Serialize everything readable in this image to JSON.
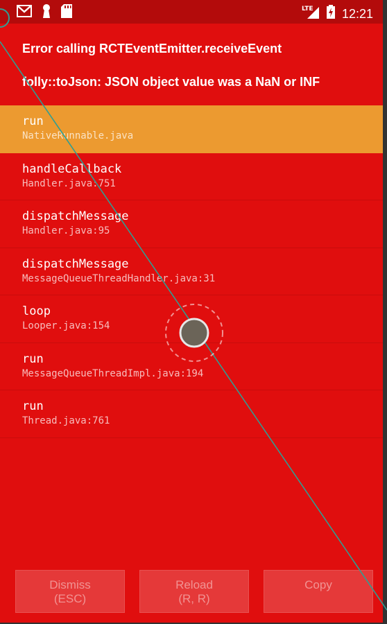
{
  "status_bar": {
    "icons": [
      "gmail-icon",
      "keyhole-icon",
      "sd-card-icon"
    ],
    "network": "LTE",
    "time": "12:21"
  },
  "error": {
    "title": "Error calling RCTEventEmitter.receiveEvent",
    "message": "folly::toJson: JSON object value was a NaN or INF"
  },
  "stack_frames": [
    {
      "method": "run",
      "file": "NativeRunnable.java",
      "highlighted": true
    },
    {
      "method": "handleCallback",
      "file": "Handler.java:751"
    },
    {
      "method": "dispatchMessage",
      "file": "Handler.java:95"
    },
    {
      "method": "dispatchMessage",
      "file": "MessageQueueThreadHandler.java:31"
    },
    {
      "method": "loop",
      "file": "Looper.java:154"
    },
    {
      "method": "run",
      "file": "MessageQueueThreadImpl.java:194"
    },
    {
      "method": "run",
      "file": "Thread.java:761"
    }
  ],
  "buttons": {
    "dismiss_line1": "Dismiss",
    "dismiss_line2": "(ESC)",
    "reload_line1": "Reload",
    "reload_line2": "(R, R)",
    "copy": "Copy"
  },
  "colors": {
    "background": "#e00e0e",
    "status_bar": "#b30b0b",
    "highlight": "#ec9a30",
    "touch_line": "#2f9e93"
  }
}
